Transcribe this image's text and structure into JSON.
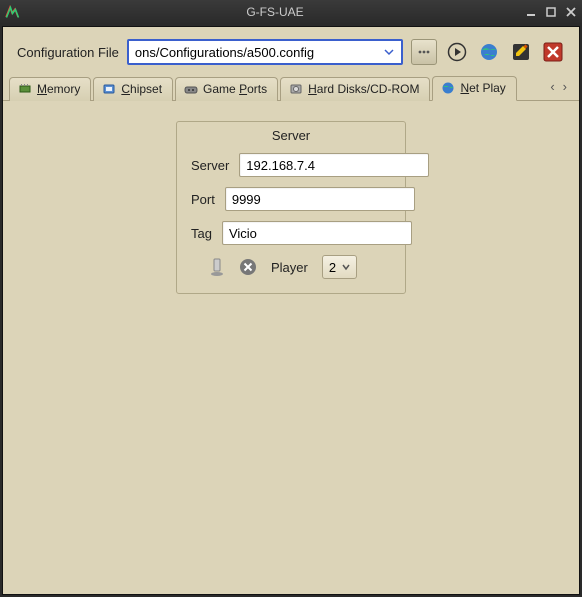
{
  "window": {
    "title": "G-FS-UAE"
  },
  "toolbar": {
    "config_label": "Configuration File",
    "config_value": "ons/Configurations/a500.config"
  },
  "tabs": [
    {
      "label_pre": "",
      "label_u": "M",
      "label_post": "emory",
      "icon": "memory-icon"
    },
    {
      "label_pre": "",
      "label_u": "C",
      "label_post": "hipset",
      "icon": "chipset-icon"
    },
    {
      "label_pre": "Game ",
      "label_u": "P",
      "label_post": "orts",
      "icon": "gameports-icon"
    },
    {
      "label_pre": "",
      "label_u": "H",
      "label_post": "ard Disks/CD-ROM",
      "icon": "harddisk-icon"
    },
    {
      "label_pre": "",
      "label_u": "N",
      "label_post": "et Play",
      "icon": "netplay-icon"
    }
  ],
  "netplay": {
    "group_title": "Server",
    "server_label": "Server",
    "server_value": "192.168.7.4",
    "port_label": "Port",
    "port_value": "9999",
    "tag_label": "Tag",
    "tag_value": "Vicio",
    "player_label": "Player",
    "player_value": "2"
  }
}
